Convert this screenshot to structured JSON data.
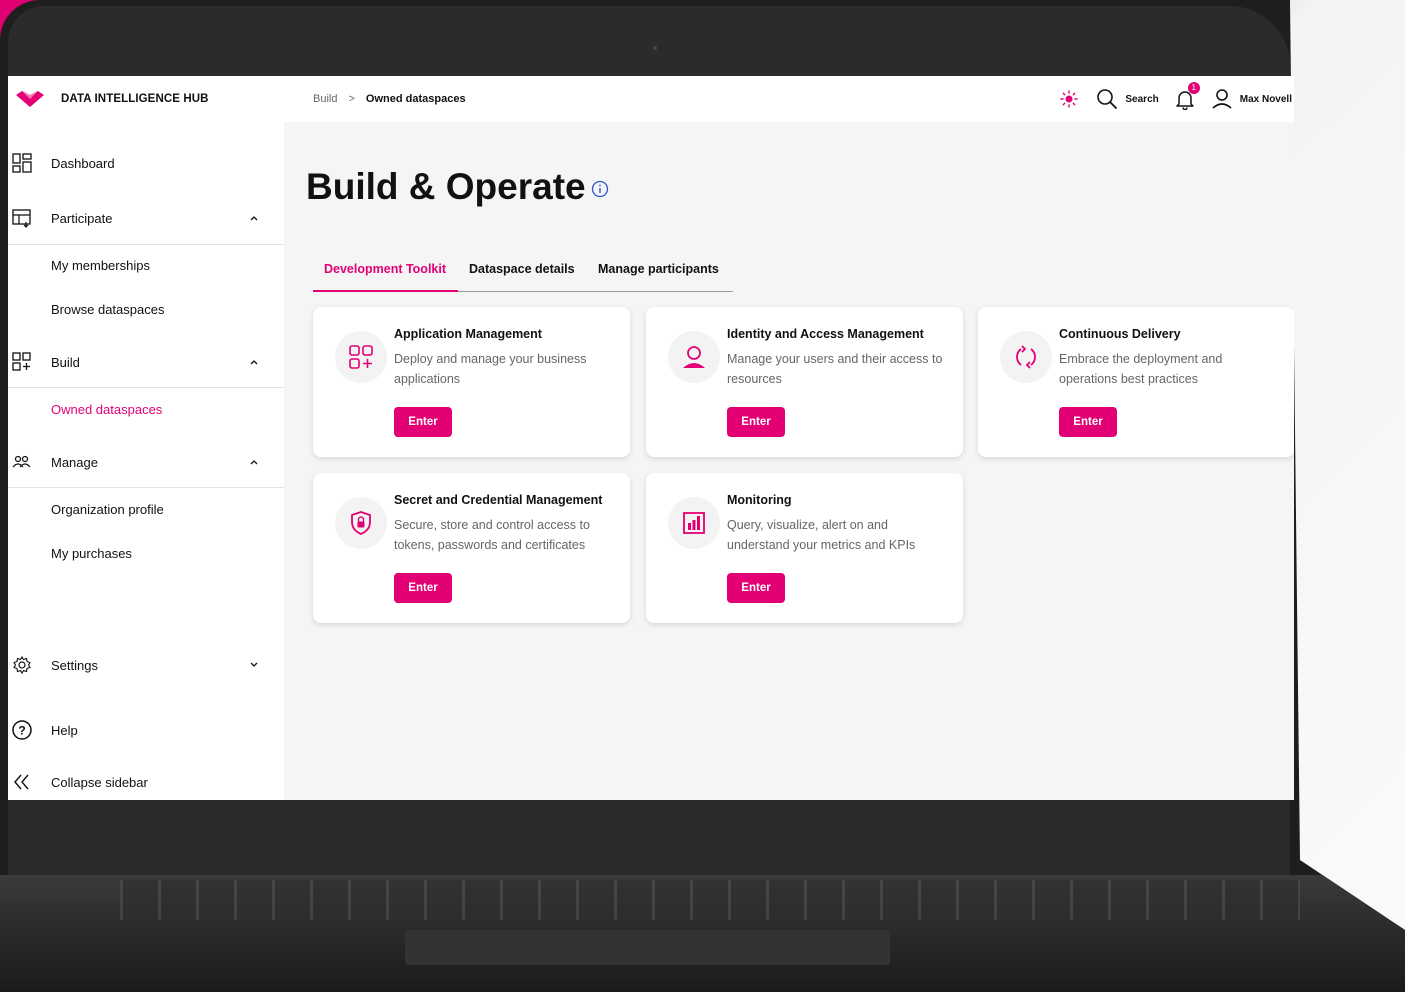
{
  "colors": {
    "accent": "#e20074",
    "text": "#111111",
    "muted": "#666666",
    "background": "#f5f5f5"
  },
  "brand": {
    "name": "DATA INTELLIGENCE HUB",
    "logo_icon": "dih-logo-icon"
  },
  "breadcrumb": {
    "items": [
      "Build",
      "Owned dataspaces"
    ],
    "separator": ">"
  },
  "topbar": {
    "theme_icon": "sun-icon",
    "search_label": "Search",
    "notifications_count": "1",
    "user_name": "Max Novell"
  },
  "sidebar": {
    "dashboard": "Dashboard",
    "participate": "Participate",
    "participate_items": [
      "My memberships",
      "Browse dataspaces"
    ],
    "build": "Build",
    "build_items": [
      "Owned dataspaces"
    ],
    "manage": "Manage",
    "manage_items": [
      "Organization profile",
      "My purchases"
    ],
    "settings": "Settings",
    "help": "Help",
    "collapse": "Collapse sidebar"
  },
  "main": {
    "title": "Build & Operate",
    "tabs": [
      "Development Toolkit",
      "Dataspace details",
      "Manage participants"
    ],
    "active_tab": "Development Toolkit",
    "cards": [
      {
        "title": "Application Management",
        "description": "Deploy and manage your business applications",
        "button": "Enter",
        "icon": "app-grid-icon"
      },
      {
        "title": "Identity and Access Management",
        "description": "Manage your users and their access to resources",
        "button": "Enter",
        "icon": "user-icon"
      },
      {
        "title": "Continuous Delivery",
        "description": "Embrace the deployment and operations best practices",
        "button": "Enter",
        "icon": "refresh-icon"
      },
      {
        "title": "Secret and Credential Management",
        "description": "Secure, store and control access to tokens, passwords and certificates",
        "button": "Enter",
        "icon": "shield-lock-icon"
      },
      {
        "title": "Monitoring",
        "description": "Query, visualize, alert on and understand your metrics and KPIs",
        "button": "Enter",
        "icon": "bar-chart-icon"
      }
    ]
  }
}
